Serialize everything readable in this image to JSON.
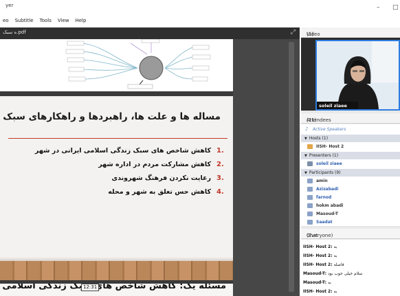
{
  "window": {
    "title": "yer",
    "minimize_glyph": "–",
    "maximize_glyph": "□"
  },
  "menu": [
    "eo",
    "Subtitle",
    "Tools",
    "View",
    "Help"
  ],
  "document": {
    "filename": "ه سبک.pdf",
    "expand_icon": "expand-icon",
    "slide_title": "مساله ها و علت ها، راهبردها و راهکارهای سبک زندگی",
    "items": [
      {
        "num": "1.",
        "text": "کاهش شاخص های سبک زندگی اسلامی ایرانی در شهر"
      },
      {
        "num": "2.",
        "text": "کاهش مشارکت مردم در اداره شهر"
      },
      {
        "num": "3.",
        "text": "رعایت نکردن فرهنگ شهروندی"
      },
      {
        "num": "4.",
        "text": "کاهش حس تعلق به شهر و محله"
      }
    ],
    "next_slide_title": "مسئله یک: کاهش شاخص های سبک زندگی اسلامی ایرانی در شهر",
    "timestamp": "12:31",
    "accent_color": "#c0392b"
  },
  "video": {
    "label": "Video",
    "count": "(1)",
    "participant_name": "soleil ziaee",
    "highlight_color": "#2d7de0"
  },
  "attendees": {
    "label": "Attendees",
    "count": "(11)",
    "active_speakers": "Active Speakers",
    "hosts_label": "Hosts (1)",
    "hosts": [
      "IISH- Host 2"
    ],
    "presenters_label": "Presenters (1)",
    "presenters": [
      "soleil ziaee"
    ],
    "participants_label": "Participants (9)",
    "participants": [
      {
        "name": "amin",
        "blue": false
      },
      {
        "name": "Azizabadi",
        "blue": true
      },
      {
        "name": "farnod",
        "blue": true
      },
      {
        "name": "hokm abadi",
        "blue": false
      },
      {
        "name": "Masoud-T",
        "blue": false
      },
      {
        "name": "Saadat",
        "blue": true
      }
    ]
  },
  "chat": {
    "label": "Chat",
    "scope": "(Everyone)",
    "messages": [
      {
        "sender": "IISH- Host 2:",
        "text": "به"
      },
      {
        "sender": "IISH- Host 2:",
        "text": "به"
      },
      {
        "sender": "IISH- Host 2:",
        "text": "فاصله"
      },
      {
        "sender": "Masoud-T:",
        "text": "سلام خیلی خوب بود"
      },
      {
        "sender": "Masoud-T:",
        "text": "به"
      },
      {
        "sender": "IISH- Host 2:",
        "text": "به"
      }
    ]
  }
}
